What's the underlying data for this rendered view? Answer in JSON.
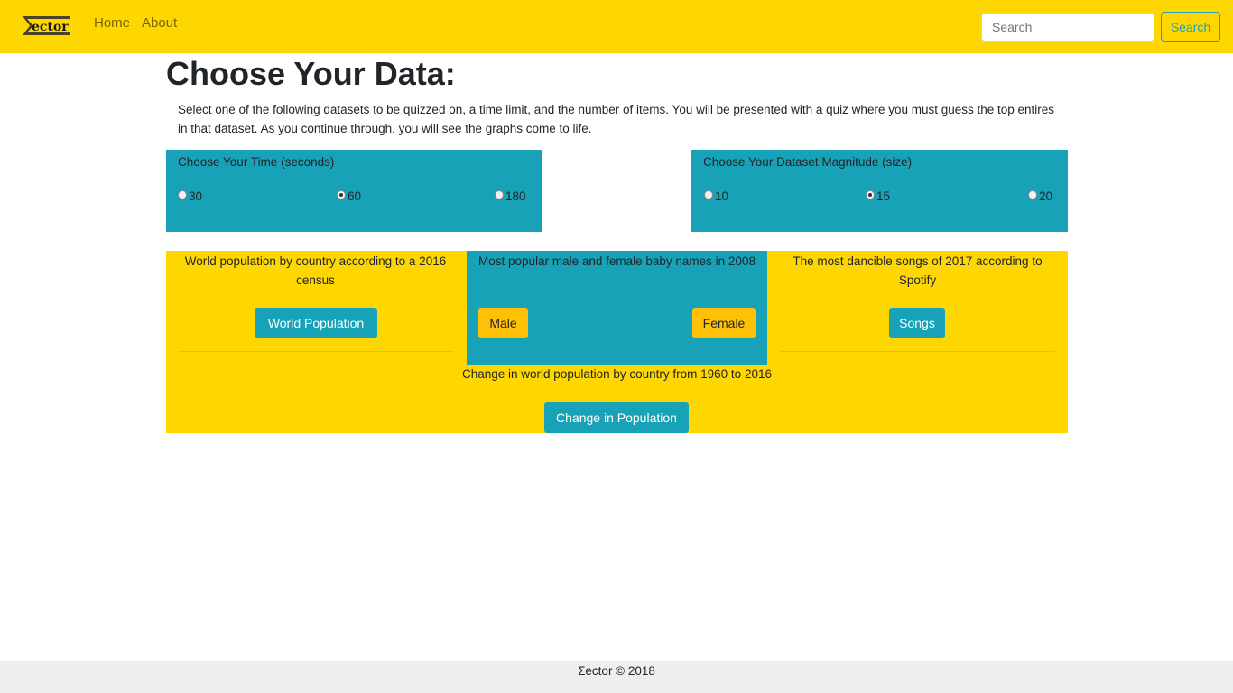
{
  "navbar": {
    "brand": "ector",
    "links": {
      "home": "Home",
      "about": "About"
    },
    "search_placeholder": "Search",
    "search_button": "Search",
    "bg_color": "#FFD700"
  },
  "main": {
    "title": "Choose Your Data:",
    "intro": "Select one of the following datasets to be quizzed on, a time limit, and the number of items. You will be presented with a quiz where you must guess the top entires in that dataset. As you continue through, you will see the graphs come to life."
  },
  "time_options": {
    "label": "Choose Your Time (seconds)",
    "options": [
      "30",
      "60",
      "180"
    ],
    "selected": "60"
  },
  "size_options": {
    "label": "Choose Your Dataset Magnitude (size)",
    "options": [
      "10",
      "15",
      "20"
    ],
    "selected": "15"
  },
  "datasets": {
    "world_population": {
      "description": "World population by country according to a 2016 census",
      "button": "World Population"
    },
    "baby_names": {
      "description": "Most popular male and female baby names in 2008",
      "male_button": "Male",
      "female_button": "Female"
    },
    "songs": {
      "description": "The most dancible songs of 2017 according to Spotify",
      "button": "Songs"
    },
    "population_change": {
      "description": "Change in world population by country from 1960 to 2016",
      "button": "Change in Population"
    }
  },
  "footer": {
    "text": "Σector © 2018"
  },
  "colors": {
    "accent_yellow": "#FFD700",
    "teal": "#17a2b8",
    "amber": "#FFC107",
    "footer_bg": "#eeeeee"
  }
}
